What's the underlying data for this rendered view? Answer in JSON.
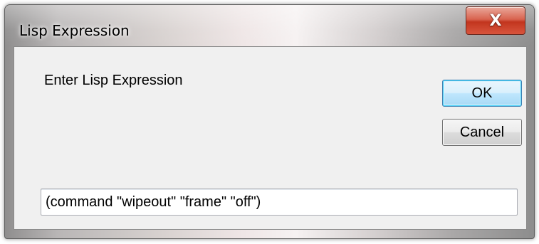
{
  "window": {
    "title": "Lisp Expression",
    "close_label": "X"
  },
  "dialog": {
    "prompt": "Enter Lisp Expression",
    "ok_label": "OK",
    "cancel_label": "Cancel",
    "expression_value": "(command \"wipeout\" \"frame\" \"off\")"
  },
  "colors": {
    "close_button": "#c2351e",
    "default_button_border": "#3c7fb1",
    "client_background": "#f0f0f0"
  }
}
